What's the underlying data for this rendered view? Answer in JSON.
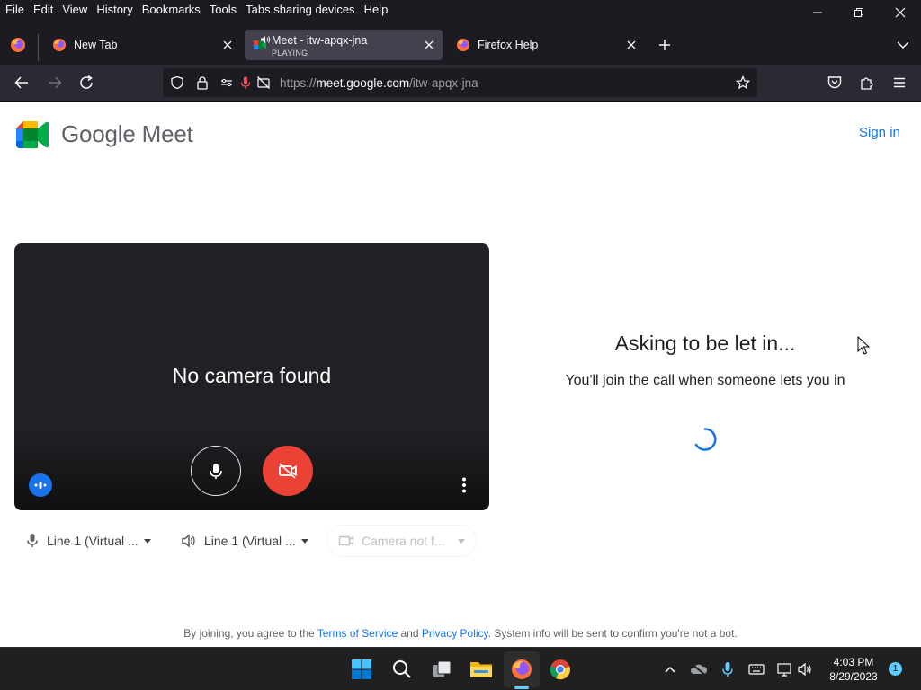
{
  "menubar": {
    "items": [
      "File",
      "Edit",
      "View",
      "History",
      "Bookmarks",
      "Tools",
      "Tabs sharing devices",
      "Help"
    ]
  },
  "tabs": [
    {
      "title": "New Tab",
      "subtitle": "",
      "active": false
    },
    {
      "title": "Meet - itw-apqx-jna",
      "subtitle": "PLAYING",
      "active": true
    },
    {
      "title": "Firefox Help",
      "subtitle": "",
      "active": false
    }
  ],
  "urlbar": {
    "prefix": "https://",
    "host": "meet.google.com",
    "path": "/itw-apqx-jna"
  },
  "page": {
    "logo_text": "Google Meet",
    "signin_label": "Sign in",
    "preview": {
      "no_camera_text": "No camera found"
    },
    "devices": {
      "microphone": "Line 1 (Virtual ...",
      "speaker": "Line 1 (Virtual ...",
      "camera": "Camera not f..."
    },
    "status": {
      "title": "Asking to be let in...",
      "subtitle": "You'll join the call when someone lets you in"
    },
    "legal": {
      "text1": "By joining, you agree to the",
      "terms": "Terms of Service",
      "and": "and",
      "privacy": "Privacy Policy",
      "text2": ". System info will be sent to confirm you're not a bot."
    }
  },
  "taskbar": {
    "time": "4:03 PM",
    "date": "8/29/2023",
    "notifications": "1"
  },
  "colors": {
    "meet_blue": "#1a73e8",
    "cam_off_red": "#ea4335",
    "chrome_dark": "#1c1b22",
    "toolbar": "#2b2a33"
  }
}
